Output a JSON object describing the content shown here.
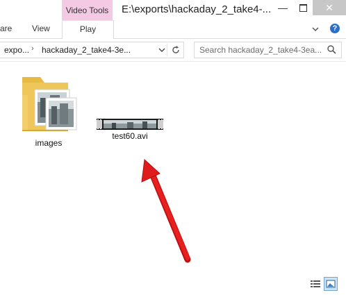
{
  "window": {
    "title": "E:\\exports\\hackaday_2_take4-...",
    "context_tab_group": "Video Tools",
    "minimize_glyph": "—",
    "close_glyph": "✕"
  },
  "ribbon": {
    "tabs": [
      {
        "label": "are"
      },
      {
        "label": "View"
      },
      {
        "label": "Play"
      }
    ],
    "help_glyph": "?"
  },
  "address": {
    "breadcrumbs": [
      "expo...",
      "hackaday_2_take4-3e..."
    ],
    "separator": "›"
  },
  "search": {
    "placeholder": "Search hackaday_2_take4-3ea..."
  },
  "files": [
    {
      "name": "images",
      "type": "folder",
      "icon": "folder-icon"
    },
    {
      "name": "test60.avi",
      "type": "video",
      "icon": "video-thumbnail"
    }
  ],
  "annotation": {
    "icon": "red-arrow",
    "color": "#e01b1b"
  },
  "colors": {
    "context_tab": "#f4c9e4",
    "close_button": "#c7c7c7",
    "selected_view": "#cce4f7"
  },
  "view_modes": {
    "active": "large-icons"
  }
}
